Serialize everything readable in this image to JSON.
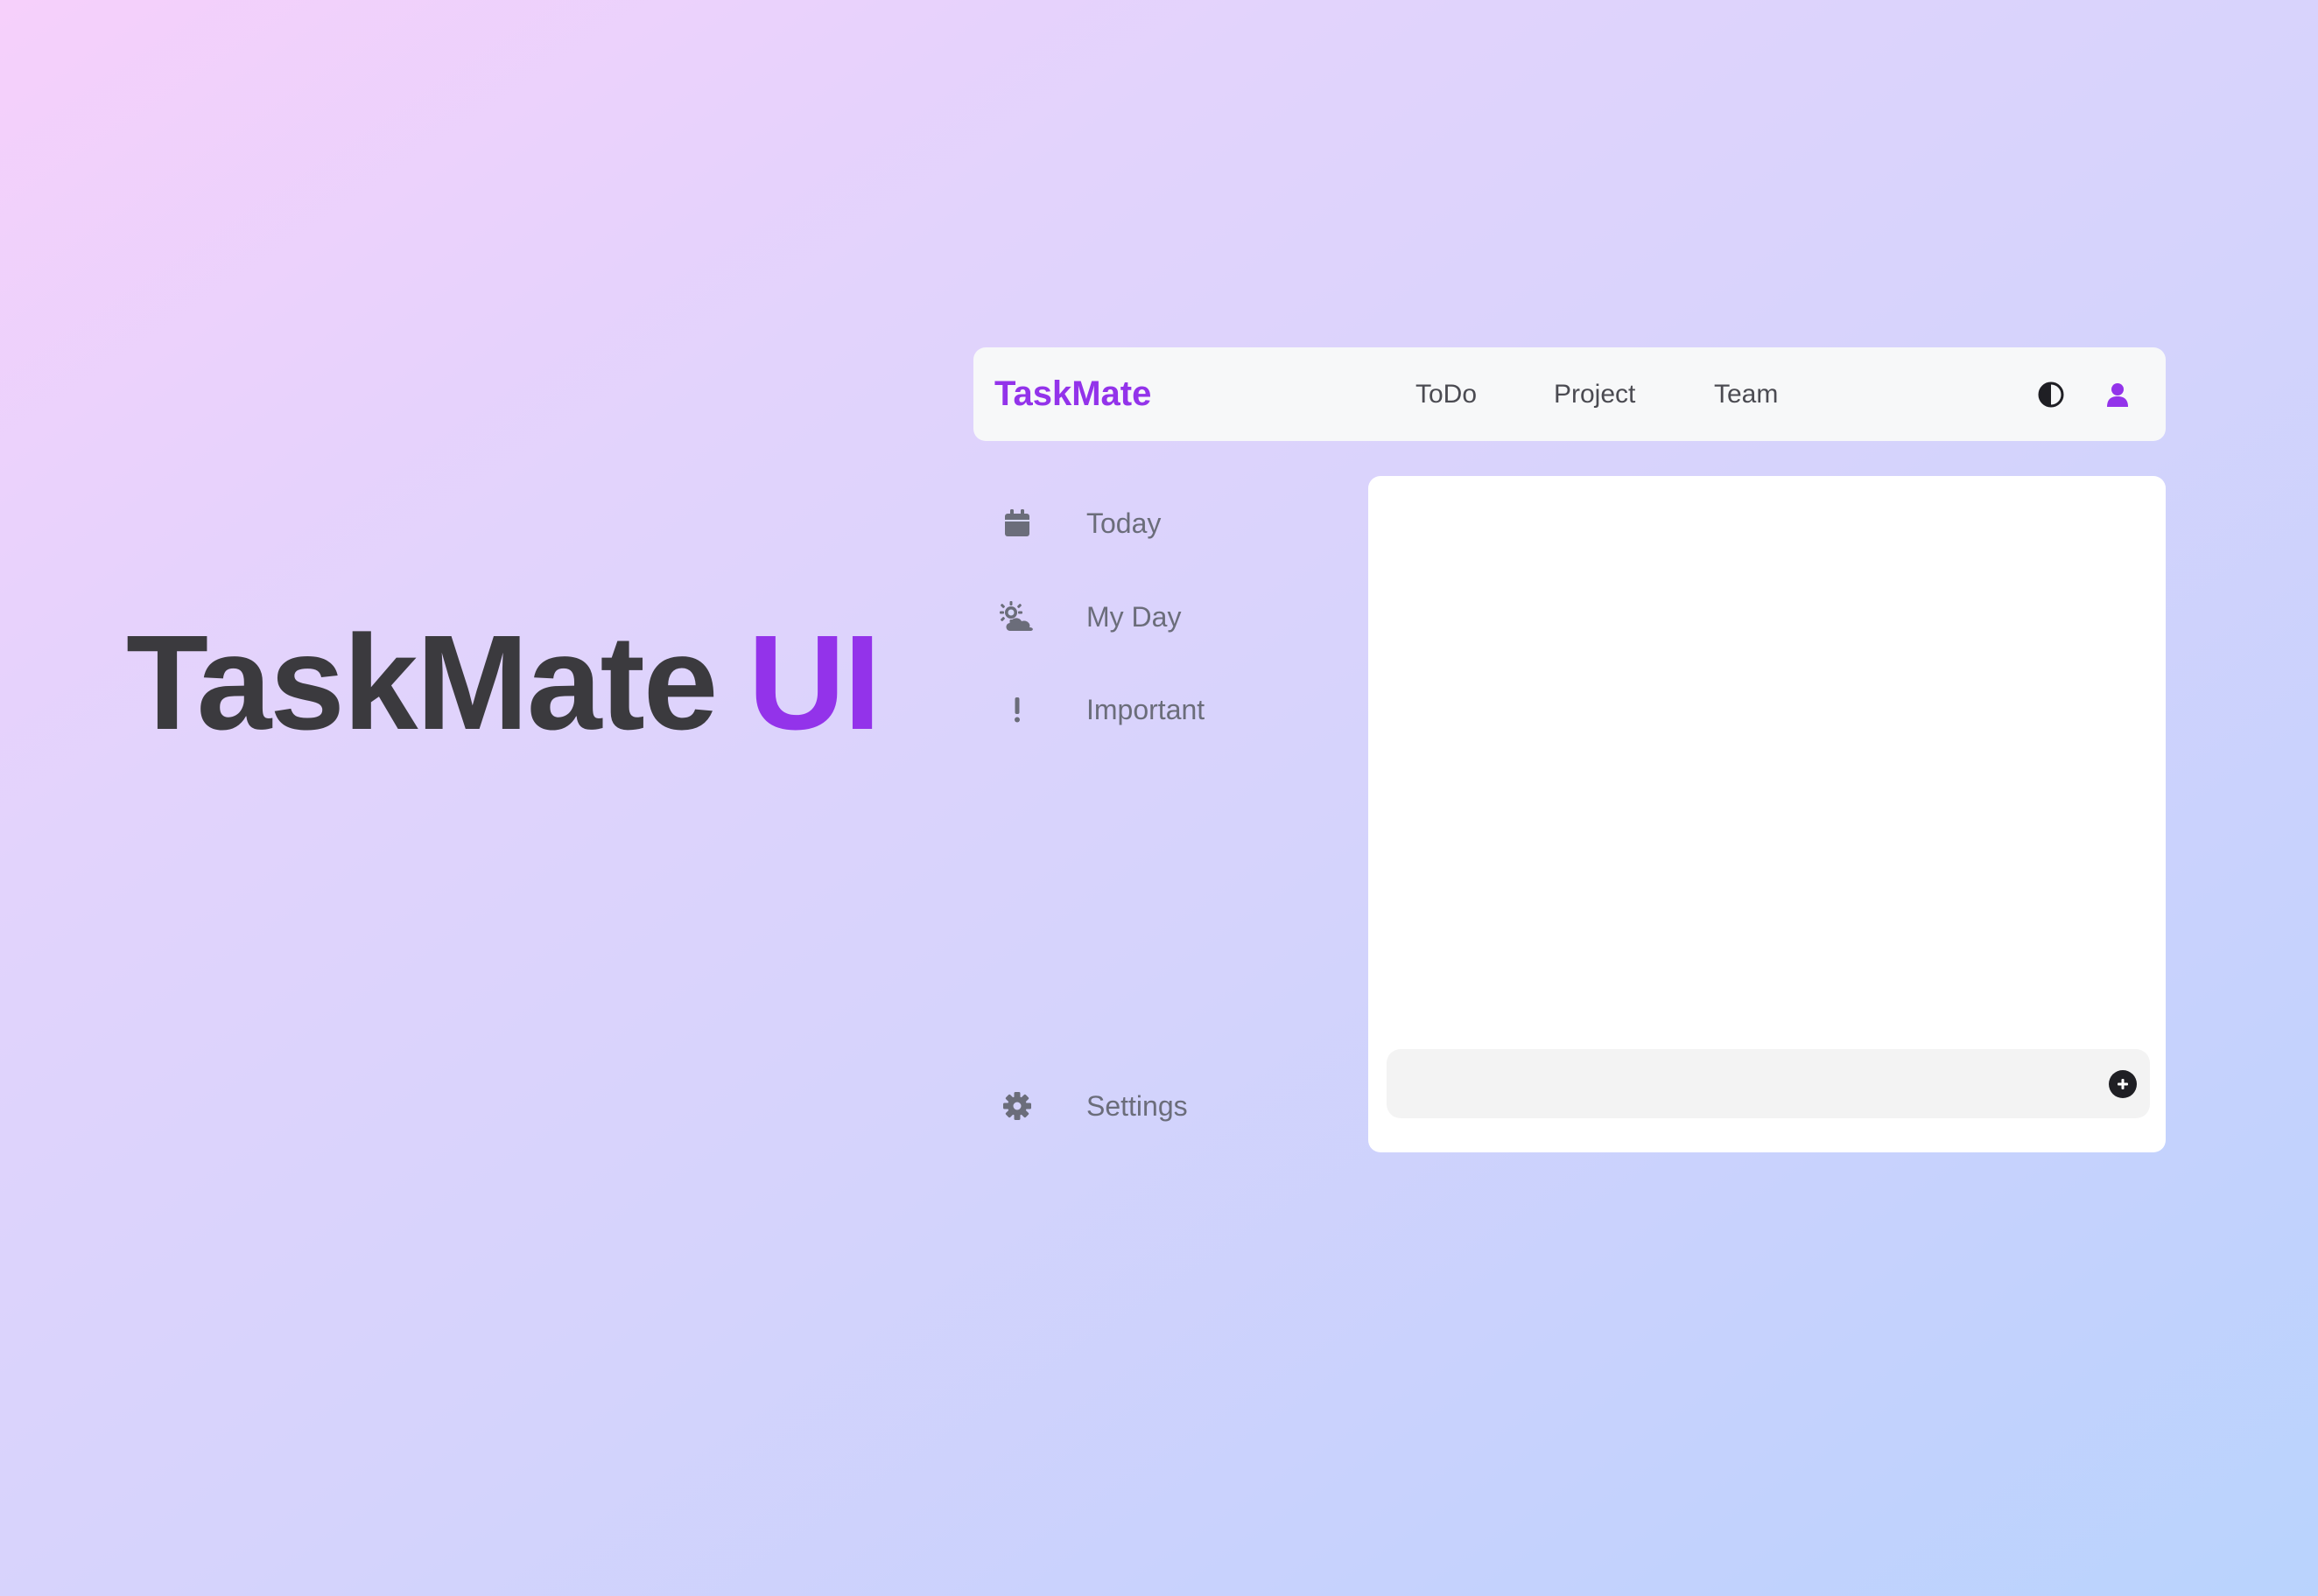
{
  "hero": {
    "title_main": "TaskMate",
    "title_accent": "UI"
  },
  "navbar": {
    "brand": "TaskMate",
    "links": [
      {
        "label": "ToDo"
      },
      {
        "label": "Project"
      },
      {
        "label": "Team"
      }
    ],
    "icons": {
      "theme": "contrast-icon",
      "user": "user-icon"
    }
  },
  "sidebar": {
    "items": [
      {
        "label": "Today",
        "icon": "calendar-icon"
      },
      {
        "label": "My Day",
        "icon": "sun-cloud-icon"
      },
      {
        "label": "Important",
        "icon": "exclamation-icon"
      }
    ],
    "settings": {
      "label": "Settings",
      "icon": "gear-icon"
    }
  },
  "main": {
    "task_input": {
      "value": "",
      "placeholder": ""
    },
    "add_icon": "plus-circle-icon"
  },
  "colors": {
    "accent": "#9333ea",
    "text_dark": "#3b3a3e",
    "sidebar_text": "#6b6d7a",
    "nav_bg": "#f7f8f9"
  }
}
